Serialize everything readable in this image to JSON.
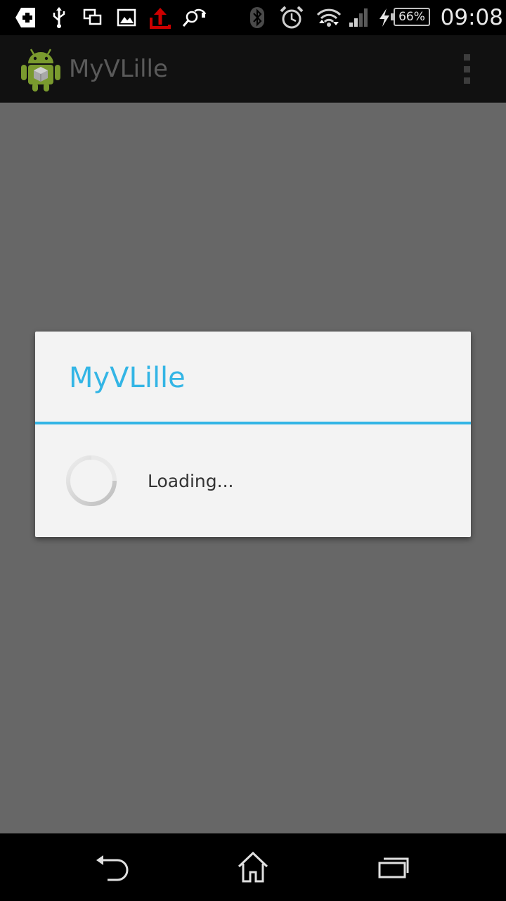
{
  "status_bar": {
    "icons": [
      "app-notification-icon",
      "usb-icon",
      "screen-mirror-icon",
      "gallery-icon",
      "upload-icon",
      "headset-search-icon",
      "bluetooth-icon",
      "alarm-icon",
      "wifi-icon",
      "signal-icon",
      "charging-icon"
    ],
    "battery": "66%",
    "time": "09:08",
    "colors": {
      "upload": "#cc0000"
    }
  },
  "action_bar": {
    "title": "MyVLille",
    "icon": "android-app-icon",
    "overflow_icon": "overflow-menu-icon"
  },
  "dialog": {
    "title": "MyVLille",
    "message": "Loading...",
    "accent_color": "#33b5e5"
  },
  "nav_bar": {
    "buttons": [
      "back-icon",
      "home-icon",
      "recent-apps-icon"
    ]
  }
}
